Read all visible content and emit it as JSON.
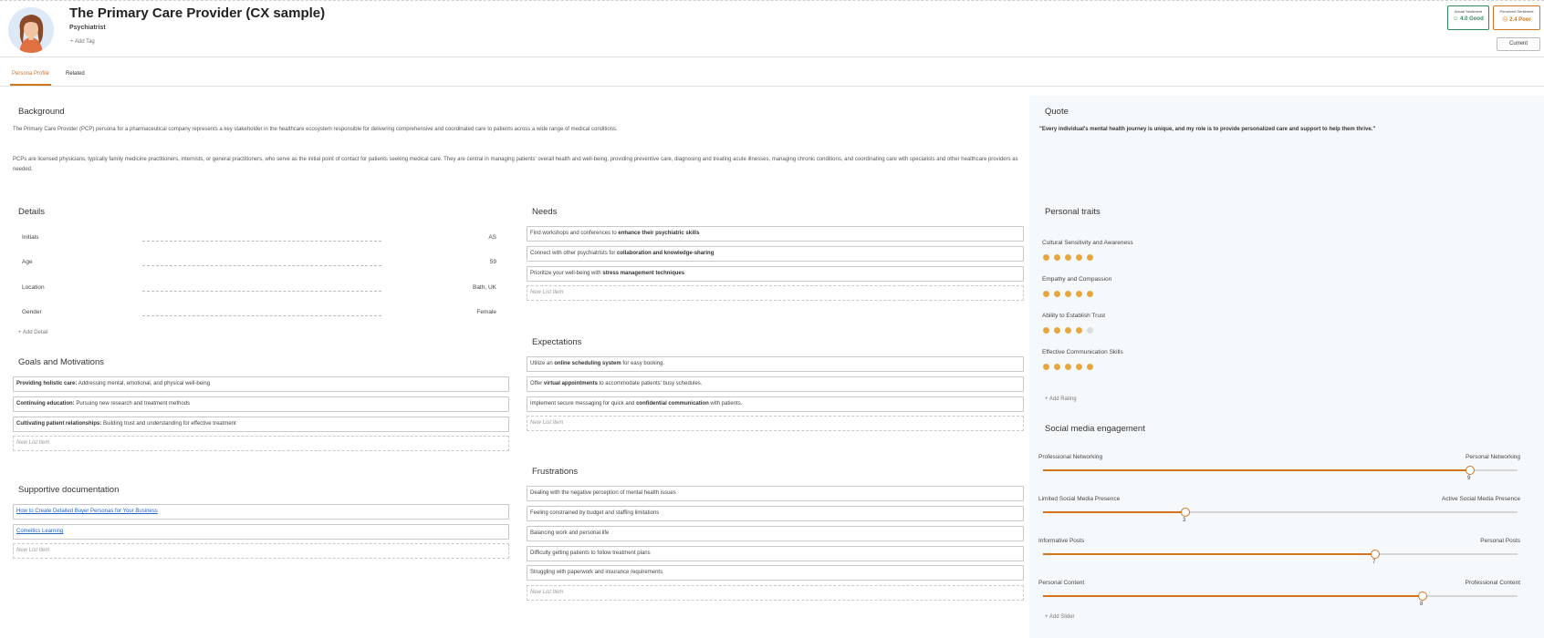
{
  "header": {
    "title": "The Primary Care Provider (CX sample)",
    "subtitle": "Psychiatrist",
    "add_tag": "Add Tag",
    "actual_sentiment": {
      "label": "Actual Sentiment",
      "value": "4.0 Good",
      "color": "#2d8a5e"
    },
    "perceived_sentiment": {
      "label": "Perceived Sentiment",
      "value": "2.4 Poor",
      "color": "#d3741f"
    },
    "current_button": "Current"
  },
  "tabs": [
    {
      "label": "Persona Profile",
      "active": true
    },
    {
      "label": "Related",
      "active": false
    }
  ],
  "background": {
    "title": "Background",
    "p1": "The Primary Care Provider (PCP) persona for a pharmaceutical company represents a key stakeholder in the healthcare ecosystem responsible for delivering comprehensive and coordinated care to patients across a wide range of medical conditions.",
    "p2": "PCPs are licensed physicians, typically family medicine practitioners, internists, or general practitioners, who serve as the initial point of contact for patients seeking medical care. They are central in managing patients' overall health and well-being, providing preventive care, diagnosing and treating acute illnesses, managing chronic conditions, and coordinating care with specialists and other healthcare providers as needed."
  },
  "quote": {
    "title": "Quote",
    "text": "\"Every individual's mental health journey is unique, and my role is to provide personalized care and support to help them thrive.\""
  },
  "details": {
    "title": "Details",
    "rows": [
      {
        "key": "Initials",
        "value": "AS"
      },
      {
        "key": "Age",
        "value": "59"
      },
      {
        "key": "Location",
        "value": "Bath, UK"
      },
      {
        "key": "Gender",
        "value": "Female"
      }
    ],
    "add_label": "Add Detail"
  },
  "goals": {
    "title": "Goals and Motivations",
    "items": [
      {
        "bold": "Providing holistic care:",
        "rest": " Addressing mental, emotional, and physical well-being"
      },
      {
        "bold": "Continuing education:",
        "rest": " Pursuing new research and treatment methods"
      },
      {
        "bold": "Cultivating patient relationships:",
        "rest": " Building trust and understanding for effective treatment"
      }
    ],
    "new_item": "New List Item"
  },
  "docs": {
    "title": "Supportive documentation",
    "items": [
      "How to Create Detailed Buyer Personas for Your Business",
      "Comeitics Learning"
    ],
    "new_item": "New List Item"
  },
  "needs": {
    "title": "Needs",
    "items": [
      {
        "pre": "Find workshops and conferences to ",
        "bold": "enhance their psychiatric skills",
        "post": ""
      },
      {
        "pre": "Connect with other psychiatrists for ",
        "bold": "collaboration and knowledge-sharing",
        "post": ""
      },
      {
        "pre": "Prioritize your well-being with ",
        "bold": "stress management techniques",
        "post": ""
      }
    ],
    "new_item": "New List Item"
  },
  "expectations": {
    "title": "Expectations",
    "items": [
      {
        "pre": "Utilize an ",
        "bold": "online scheduling system",
        "post": " for easy booking."
      },
      {
        "pre": "Offer ",
        "bold": "virtual appointments",
        "post": " to accommodate patients' busy schedules."
      },
      {
        "pre": "Implement secure messaging for quick and ",
        "bold": "confidential communication",
        "post": " with patients."
      }
    ],
    "new_item": "New List Item"
  },
  "frustrations": {
    "title": "Frustrations",
    "items": [
      "Dealing with the negative perception of mental health issues",
      "Feeling constrained by budget and staffing limitations",
      "Balancing work and personal life",
      "Difficulty getting patients to follow treatment plans",
      "Struggling with paperwork and insurance requirements"
    ],
    "new_item": "New List Item"
  },
  "traits": {
    "title": "Personal traits",
    "items": [
      {
        "label": "Cultural Sensitivity and Awareness",
        "rating": 5,
        "max": 5
      },
      {
        "label": "Empathy and Compassion",
        "rating": 5,
        "max": 5
      },
      {
        "label": "Ability to Establish Trust",
        "rating": 4,
        "max": 5
      },
      {
        "label": "Effective Communication Skills",
        "rating": 5,
        "max": 5
      }
    ],
    "add_label": "Add Rating",
    "accent": "#e8a73d"
  },
  "social": {
    "title": "Social media engagement",
    "sliders": [
      {
        "left": "Professional Networking",
        "right": "Personal Networking",
        "value": 9,
        "max": 10
      },
      {
        "left": "Limited Social Media Presence",
        "right": "Active Social Media Presence",
        "value": 3,
        "max": 10
      },
      {
        "left": "Informative Posts",
        "right": "Personal Posts",
        "value": 7,
        "max": 10
      },
      {
        "left": "Personal Content",
        "right": "Professional Content",
        "value": 8,
        "max": 10
      }
    ],
    "add_label": "Add Slider",
    "accent": "#d3741f"
  }
}
